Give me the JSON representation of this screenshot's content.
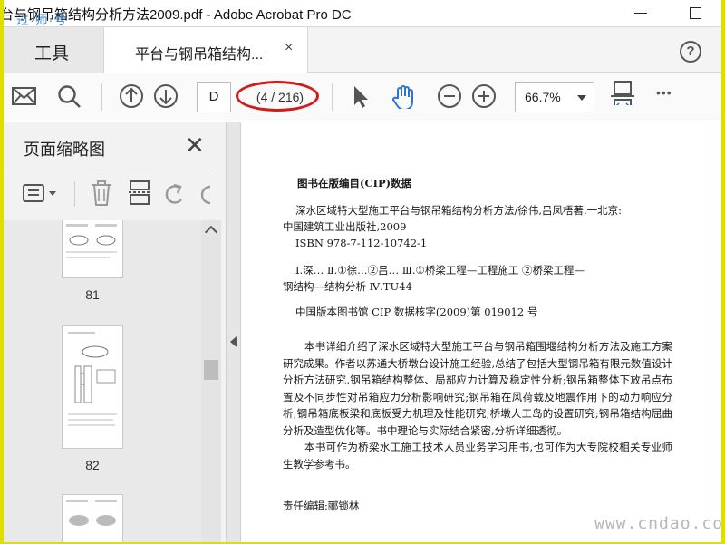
{
  "window": {
    "title": "台与钢吊箱结构分析方法2009.pdf - Adobe Acrobat Pro DC",
    "overlay_mark": "过·师·号"
  },
  "tabs": {
    "tools_label": "工具",
    "doc_tab_label": "平台与钢吊箱结构...",
    "close_glyph": "×",
    "help_glyph": "?"
  },
  "toolbar": {
    "page_input_value": "D",
    "page_count": "(4 / 216)",
    "zoom_value": "66.7%",
    "more_glyph": "•••"
  },
  "left_panel": {
    "title": "页面缩略图",
    "close_glyph": "✕",
    "thumbnails": [
      {
        "page": "81"
      },
      {
        "page": "82"
      }
    ]
  },
  "document": {
    "heading": "图书在版编目(CIP)数据",
    "lines": [
      "深水区域特大型施工平台与钢吊箱结构分析方法/徐伟,吕凤梧著.一北京:",
      "中国建筑工业出版社,2009",
      "ISBN 978-7-112-10742-1",
      "Ⅰ.深…  Ⅱ.①徐…②吕…  Ⅲ.①桥梁工程—工程施工  ②桥梁工程—",
      "钢结构—结构分析  Ⅳ.TU44",
      "中国版本图书馆 CIP 数据核字(2009)第 019012 号",
      "本书详细介绍了深水区域特大型施工平台与钢吊箱围堰结构分析方法及施工方案研究成果。作者以苏通大桥墩台设计施工经验,总结了包括大型钢吊箱有限元数值设计分析方法研究,钢吊箱结构整体、局部应力计算及稳定性分析;钢吊箱整体下放吊点布置及不同步性对吊箱应力分析影响研究;钢吊箱在风荷载及地震作用下的动力响应分析;钢吊箱底板梁和底板受力机理及性能研究;桥墩人工岛的设置研究;钢吊箱结构屈曲分析及造型优化等。书中理论与实际结合紧密,分析详细透彻。",
      "本书可作为桥梁水工施工技术人员业务学习用书,也可作为大专院校相关专业师生教学参考书。",
      "责任编辑:郦锁林"
    ]
  },
  "watermark": "www.cndao.com",
  "colors": {
    "frame": "#e9e900",
    "annotation_oval": "#d11a1a",
    "hand_tool": "#2b74d8"
  }
}
